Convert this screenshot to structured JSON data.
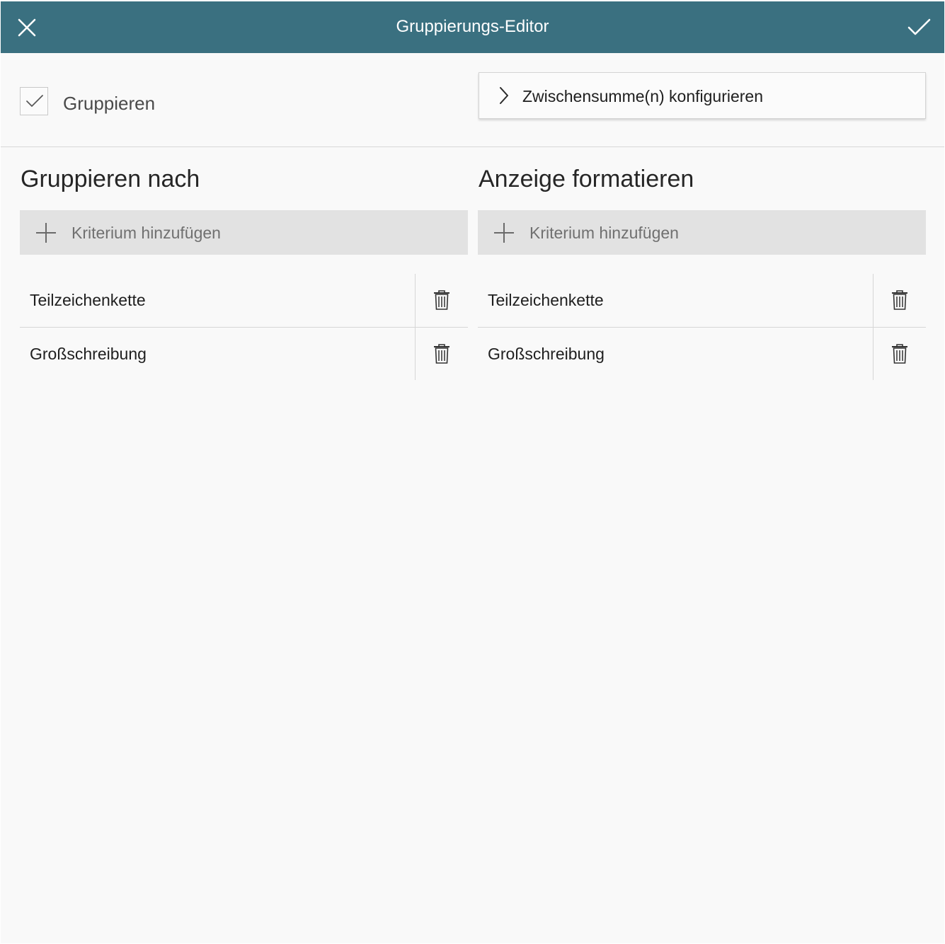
{
  "header": {
    "title": "Gruppierungs-Editor",
    "close_icon": "close-icon",
    "confirm_icon": "check-icon",
    "background_color": "#3a7080"
  },
  "options": {
    "group_checkbox_checked": true,
    "group_label": "Gruppieren",
    "subtotal_button_label": "Zwischensumme(n) konfigurieren",
    "subtotal_icon": "chevron-right-icon"
  },
  "group_by": {
    "heading": "Gruppieren nach",
    "add_label": "Kriterium hinzufügen",
    "items": [
      {
        "label": "Teilzeichenkette"
      },
      {
        "label": "Großschreibung"
      }
    ]
  },
  "format_display": {
    "heading": "Anzeige formatieren",
    "add_label": "Kriterium hinzufügen",
    "items": [
      {
        "label": "Teilzeichenkette"
      },
      {
        "label": "Großschreibung"
      }
    ]
  }
}
